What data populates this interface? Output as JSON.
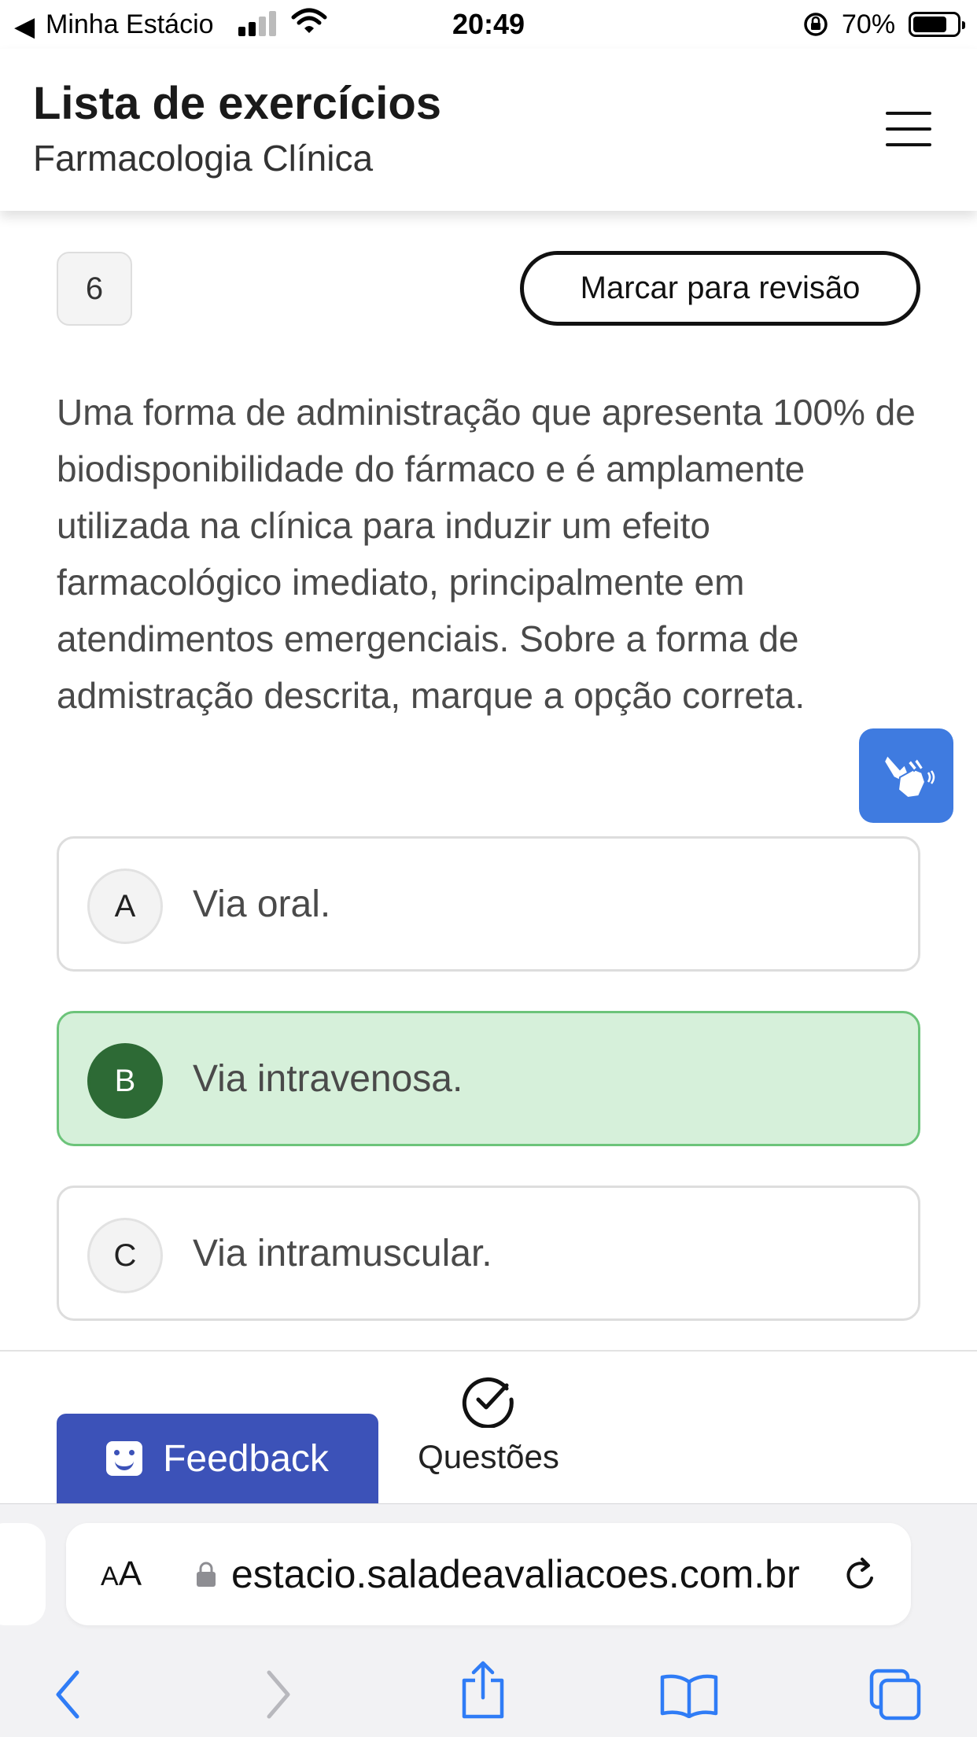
{
  "status_bar": {
    "back_app": "Minha Estácio",
    "time": "20:49",
    "battery_text": "70%",
    "battery_level": 0.7
  },
  "header": {
    "title": "Lista de exercícios",
    "subtitle": "Farmacologia Clínica"
  },
  "question": {
    "number": "6",
    "review_label": "Marcar para revisão",
    "text": "Uma forma de administração que apresenta 100% de biodisponibilidade do fármaco e é amplamente utilizada na clínica para induzir um efeito farmacológico imediato, principalmente em atendimentos emergenciais. Sobre a forma de admistração descrita, marque a opção correta.",
    "options": [
      {
        "letter": "A",
        "text": "Via oral.",
        "selected": false
      },
      {
        "letter": "B",
        "text": "Via intravenosa.",
        "selected": true
      },
      {
        "letter": "C",
        "text": "Via intramuscular.",
        "selected": false
      }
    ]
  },
  "bottom_bar": {
    "feedback_label": "Feedback",
    "questions_label": "Questões"
  },
  "browser": {
    "text_size_label_small": "A",
    "text_size_label_large": "A",
    "url": "estacio.saladeavaliacoes.com.br"
  },
  "colors": {
    "selected_background": "#d6f0da",
    "selected_border": "#6cc47a",
    "selected_letter": "#2d6a35",
    "feedback_blue": "#3c52b8",
    "libras_blue": "#3f7be0",
    "safari_blue": "#2f7cf6"
  },
  "icons": {
    "menu": "hamburger-menu-icon",
    "libras": "hand-signing-icon",
    "questions": "check-circle-icon",
    "feedback": "smile-icon"
  }
}
